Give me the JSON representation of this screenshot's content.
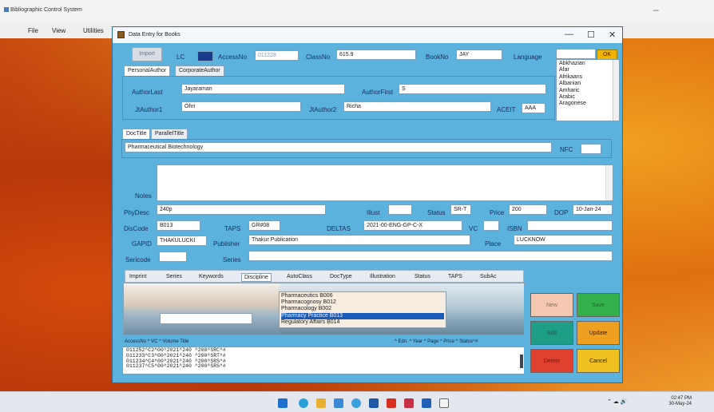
{
  "outer": {
    "title": "Bibliographic Control System",
    "menu": [
      "File",
      "View",
      "Utilities"
    ],
    "minimize_glyph": "–"
  },
  "dialog": {
    "title": "Data Entry for Books",
    "controls": [
      "—",
      "☐",
      "✕"
    ]
  },
  "top": {
    "import_label": "Import",
    "lc_label": "LC",
    "lc_value": "",
    "accessno_label": "AccessNo",
    "accessno_value": "011228",
    "classno_label": "ClassNo",
    "classno_value": "615.9",
    "bookno_label": "BookNo",
    "bookno_value": "JAY",
    "language_label": "Language",
    "language_input": "",
    "ok_label": "OK",
    "languages": [
      "Abkhazian",
      "Afar",
      "Afrikaans",
      "Albanian",
      "Amharic",
      "Arabic",
      "Aragonese"
    ]
  },
  "author_tabs": [
    "PersonalAuthor",
    "CorporateAuthor"
  ],
  "author": {
    "last_label": "AuthorLast",
    "last_value": "Jayaraman",
    "first_label": "AuthorFirst",
    "first_value": "S",
    "jt1_label": "JtAuthor1",
    "jt1_value": "Ohri",
    "jt2_label": "JtAuthor2",
    "jt2_value": "Richa",
    "aceit_label": "ACEIT",
    "aceit_value": "AAA"
  },
  "title_tabs": [
    "DocTitle",
    "ParallelTitle"
  ],
  "doctitle_value": "Pharmaceutical Biotechnology",
  "nfc_label": "NFC",
  "nfc_value": "",
  "notes_label": "Notes",
  "fields": {
    "phydesc_label": "PhyDesc",
    "phydesc_value": "240p",
    "illust_label": "Illust",
    "illust_value": "",
    "status_label": "Status",
    "status_value": "SR-T",
    "price_label": "Price",
    "price_value": "200",
    "dop_label": "DOP",
    "dop_value": "10-Jan-24",
    "discode_label": "DisCode",
    "discode_value": "B013",
    "taps_label": "TAPS",
    "taps_value": "GR#08",
    "deltas_label": "DELTAS",
    "deltas_value": "2021-00-ENG-GP-C-X",
    "vc_label": "VC",
    "vc_value": "",
    "isbn_label": "ISBN",
    "isbn_value": "",
    "gapid_label": "GAPID",
    "gapid_value": "THAKULUCKI",
    "publisher_label": "Publisher",
    "publisher_value": "Thakur Publication",
    "place_label": "Place",
    "place_value": "LUCKNOW",
    "sericode_label": "Sericode",
    "sericode_value": "",
    "series_label": "Series",
    "series_value": ""
  },
  "lower_tabs": [
    "Imprint",
    "Series",
    "Keywords",
    "Discipline",
    "AutoClass",
    "DocType",
    "Illustration",
    "Status",
    "TAPS",
    "SubAc"
  ],
  "discipline_list": [
    {
      "text": "Pharmaceutics  B006",
      "selected": false
    },
    {
      "text": "Pharmacognosy  B012",
      "selected": false
    },
    {
      "text": "Pharmacology  B002",
      "selected": false
    },
    {
      "text": "Pharmacy Practice  B013",
      "selected": true
    },
    {
      "text": "Regulatory Affairs  B014",
      "selected": false
    }
  ],
  "grid": {
    "header_left": "AccessNo  ^  VC  ^ Volume Title",
    "header_right": "^ Edn.  ^  Year  ^ Page  ^ Price  ^ Status^#",
    "rows": [
      "011252^C2^00^2021^240   ^200^SRC^#",
      "011233^C3^00^2021^240   ^200^SRT^#",
      "011234^C4^00^2021^240   ^200^SRS^#",
      "011237^C5^00^2021^240   ^200^SRS^#"
    ]
  },
  "actions": {
    "new": "New",
    "save": "Save",
    "edit": "Edit",
    "update": "Update",
    "delete": "Delete",
    "cancel": "Cancel"
  },
  "taskbar": {
    "tray_text": "⌃  ☁  🔊",
    "time": "02:47 PM",
    "date": "30-May-24"
  },
  "colors": {
    "form_bg": "#5bb3dd",
    "new_btn": "#f4c8b0",
    "save_btn": "#34b04a",
    "edit_btn": "#1e9e86",
    "update_btn": "#f0a020",
    "delete_btn": "#e04030",
    "cancel_btn": "#f0c020"
  }
}
